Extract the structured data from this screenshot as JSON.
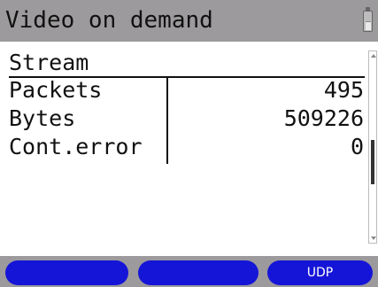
{
  "header": {
    "title": "Video on demand",
    "battery_icon": "battery-icon"
  },
  "section": {
    "title": "Stream"
  },
  "rows": [
    {
      "label": "Packets",
      "value": "495"
    },
    {
      "label": "Bytes",
      "value": "509226"
    },
    {
      "label": "Cont.error",
      "value": "0"
    }
  ],
  "softkeys": [
    {
      "label": ""
    },
    {
      "label": ""
    },
    {
      "label": "UDP"
    }
  ],
  "colors": {
    "titlebar": "#9c9a9c",
    "softkey": "#1515d7",
    "background": "#ffffff"
  }
}
